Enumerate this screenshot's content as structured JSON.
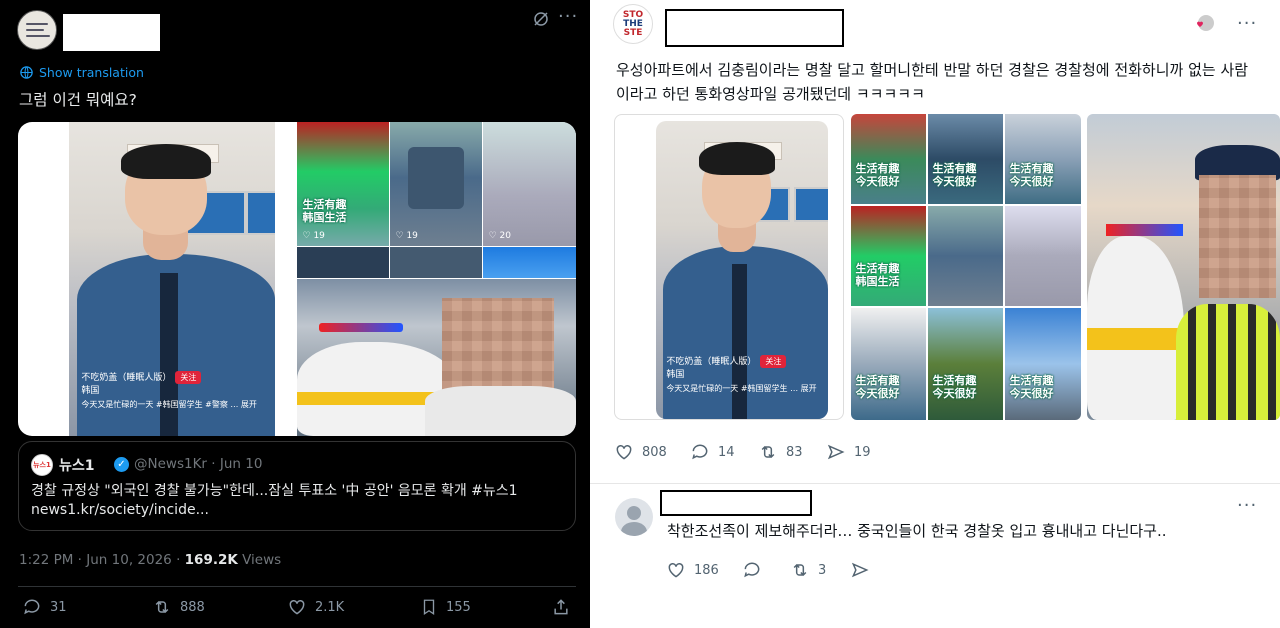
{
  "left_post": {
    "translate_label": "Show translation",
    "text": "그럼 이건 뭐예요?",
    "media": {
      "video_caption_user": "不吃奶盖（睡眠人版）",
      "video_caption_follow": "关注",
      "video_caption_location": "韩国",
      "video_caption_line": "今天又是忙碌的一天 #韩国留学生 #警察 … 展开",
      "sign_text": "흥 뜻",
      "tile_caption_1": "生活有趣\n韩国生活",
      "tile_count_1": "♡ 19",
      "tile_count_2": "♡ 19",
      "tile_count_3": "♡ 20"
    },
    "quote": {
      "logo_text": "뉴스1",
      "name": "뉴스1",
      "handle": "@News1Kr · Jun 10",
      "text": "경찰 규정상 \"외국인 경찰 불가능\"한데...잠실 투표소 '中 공안' 음모론 확개 #뉴스1",
      "link": "news1.kr/society/incide..."
    },
    "meta_time": "1:22 PM · Jun 10, 2026 · ",
    "meta_views_count": "169.2K",
    "meta_views_label": " Views",
    "actions": {
      "replies": "31",
      "reposts": "888",
      "likes": "2.1K",
      "bookmarks": "155"
    },
    "colors": {
      "background": "#000000",
      "link": "#1d9bf0",
      "muted": "#71767b"
    }
  },
  "right_post": {
    "avatar_lines": [
      "STO",
      "THE",
      "STE"
    ],
    "text": "우성아파트에서 김충림이라는 명찰 달고 할머니한테 반말 하던 경찰은 경찰청에 전화하니까 없는 사람이라고 하던 통화영상파일 공개됐던데 ㅋㅋㅋㅋㅋ",
    "media": {
      "video_caption_user": "不吃奶盖（睡眠人版）",
      "video_caption_follow": "关注",
      "video_caption_location": "韩国",
      "video_caption_line": "今天又是忙碌的一天 #韩国留学生 … 展开",
      "tile_caption_a": "生活有趣\n今天很好",
      "tile_caption_b": "生活有趣\n今天很好",
      "tile_caption_c": "生活有趣\n今天很好",
      "tile_caption_d": "生活有趣\n韩国生活",
      "tile_caption_e": "生活有趣\n今天很好",
      "tile_caption_f": "生活有趣\n今天很好",
      "tile_caption_g": "生活有趣\n今天很好"
    },
    "actions": {
      "likes": "808",
      "replies": "14",
      "reposts": "83",
      "views": "19"
    }
  },
  "reply": {
    "text": "착한조선족이 제보해주더라… 중국인들이 한국 경찰옷 입고 흉내내고 다닌다구..",
    "actions": {
      "likes": "186",
      "replies": "",
      "reposts": "3"
    }
  }
}
